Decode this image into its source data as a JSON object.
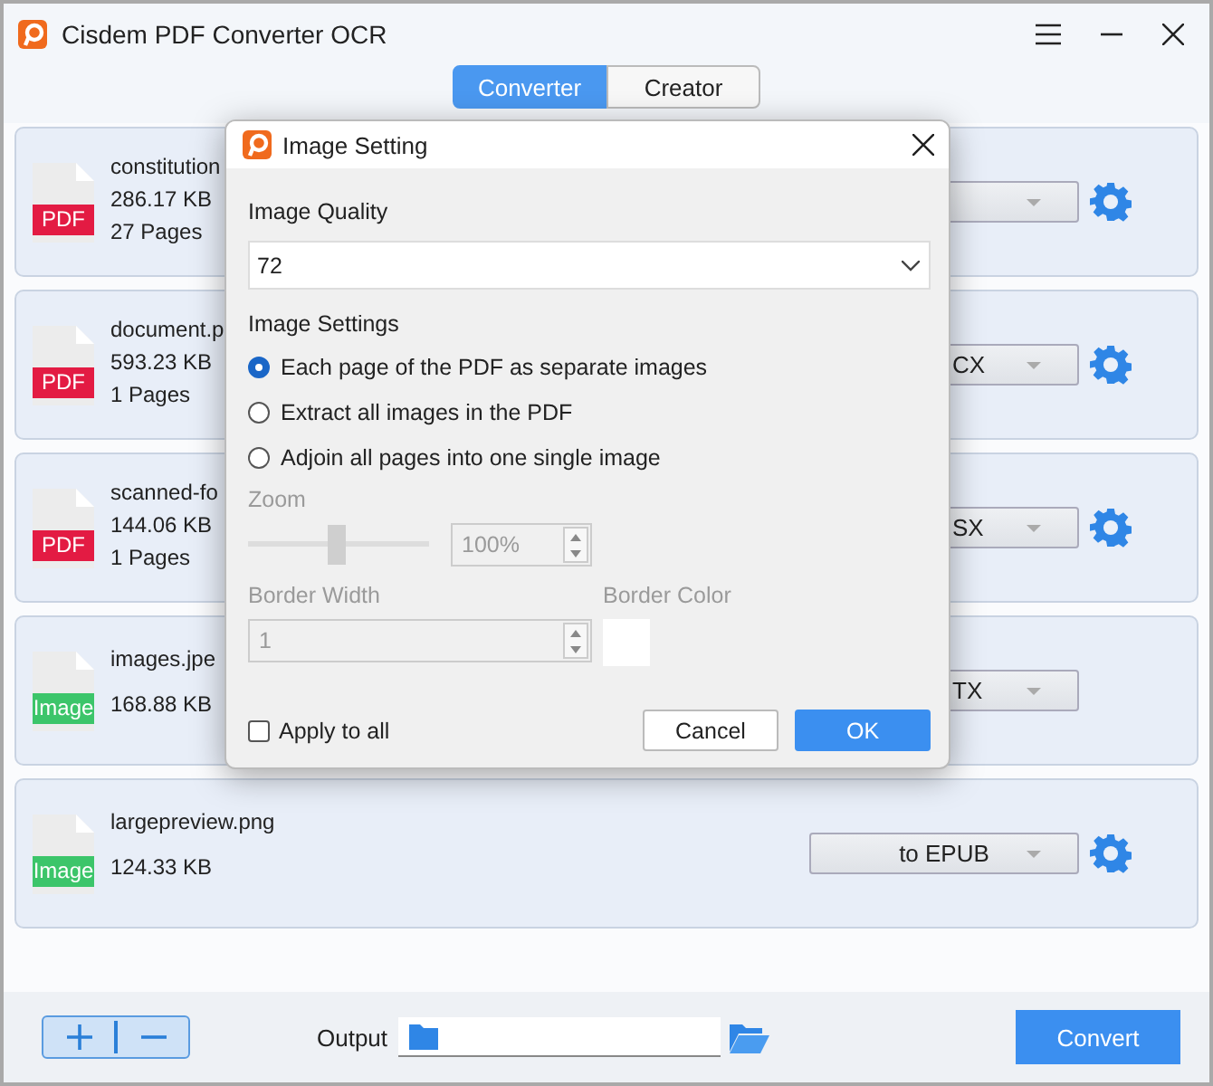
{
  "window": {
    "title": "Cisdem PDF Converter OCR"
  },
  "tabs": [
    {
      "label": "Converter",
      "selected": true
    },
    {
      "label": "Creator",
      "selected": false
    }
  ],
  "files": [
    {
      "kind": "pdf",
      "badge": "PDF",
      "name": "constitution",
      "size": "286.17 KB",
      "pages": "27 Pages",
      "settings": true
    },
    {
      "kind": "pdf",
      "badge": "PDF",
      "name": "document.p",
      "size": "593.23 KB",
      "pages": "1 Pages",
      "format": "CX",
      "settings": true
    },
    {
      "kind": "pdf",
      "badge": "PDF",
      "name": "scanned-fo",
      "size": "144.06 KB",
      "pages": "1 Pages",
      "format": "SX",
      "settings": true
    },
    {
      "kind": "image",
      "badge": "Image",
      "name": "images.jpe",
      "size": "168.88 KB",
      "format": "TX",
      "settings": false
    },
    {
      "kind": "image",
      "badge": "Image",
      "name": "largepreview.png",
      "size": "124.33 KB",
      "format": "to EPUB",
      "settings": true
    }
  ],
  "dialog": {
    "title": "Image Setting",
    "quality_label": "Image Quality",
    "quality": "72",
    "settings_label": "Image Settings",
    "options": [
      {
        "label": "Each page of the PDF as separate images",
        "selected": true
      },
      {
        "label": "Extract all images in the PDF",
        "selected": false
      },
      {
        "label": "Adjoin all pages into one single image",
        "selected": false
      }
    ],
    "zoom": {
      "label": "Zoom",
      "level": 0.49,
      "value": "100%",
      "disabled": true
    },
    "border_width": {
      "label": "Border Width",
      "value": "1",
      "disabled": true
    },
    "border_color": {
      "label": "Border Color",
      "color": "#ffffff"
    },
    "apply_all": {
      "label": "Apply to all",
      "checked": false
    },
    "buttons": [
      "Cancel",
      "OK"
    ]
  },
  "bottom": {
    "output_label": "Output",
    "convert": "Convert"
  }
}
